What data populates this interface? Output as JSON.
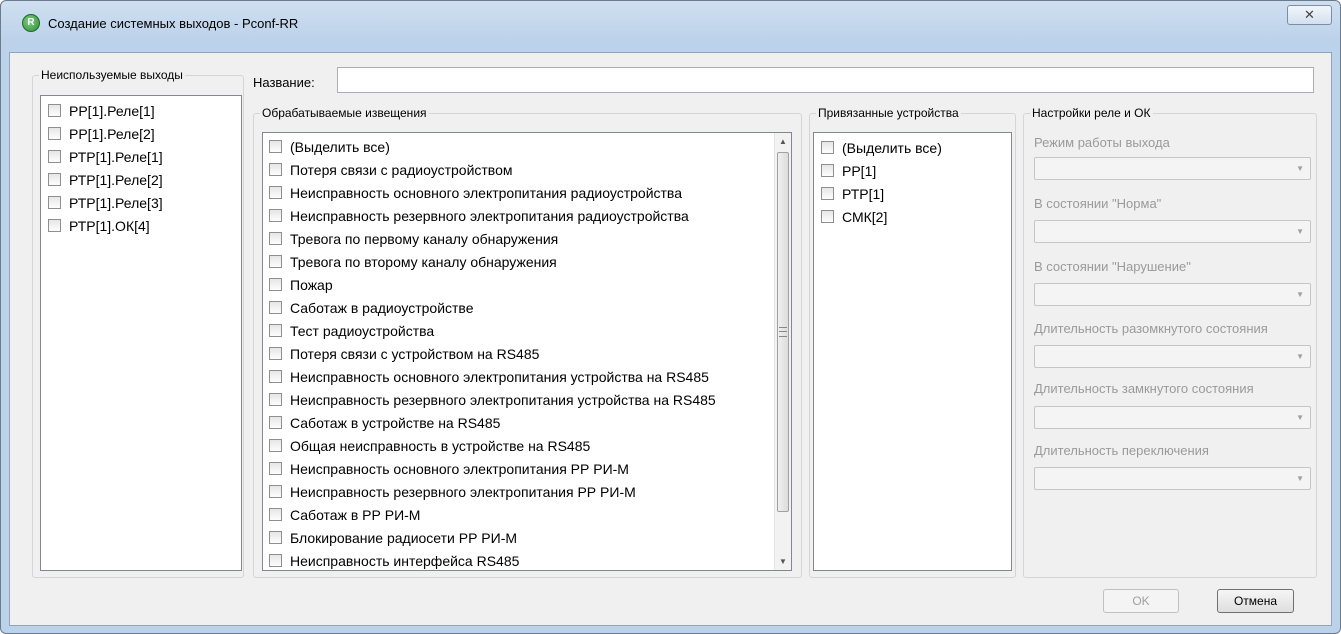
{
  "window": {
    "title": "Создание системных выходов - Pconf-RR",
    "icon_glyph": "R",
    "close_glyph": "✕"
  },
  "unused_outputs": {
    "title": "Неиспользуемые выходы",
    "items": [
      "РР[1].Реле[1]",
      "РР[1].Реле[2]",
      "РТР[1].Реле[1]",
      "РТР[1].Реле[2]",
      "РТР[1].Реле[3]",
      "РТР[1].ОК[4]"
    ]
  },
  "name_field": {
    "label": "Название:",
    "value": ""
  },
  "notifications": {
    "title": "Обрабатываемые извещения",
    "items": [
      "(Выделить все)",
      "Потеря связи с радиоустройством",
      "Неисправность основного электропитания радиоустройства",
      "Неисправность резервного электропитания радиоустройства",
      "Тревога по первому каналу обнаружения",
      "Тревога по второму каналу обнаружения",
      "Пожар",
      "Саботаж в радиоустройстве",
      "Тест радиоустройства",
      "Потеря связи с устройством на RS485",
      "Неисправность основного электропитания устройства на RS485",
      "Неисправность резервного электропитания устройства на RS485",
      "Саботаж в устройстве на RS485",
      "Общая неисправность в устройстве на RS485",
      "Неисправность основного электропитания РР РИ-М",
      "Неисправность резервного электропитания РР РИ-М",
      "Саботаж в РР РИ-М",
      "Блокирование радиосети РР РИ-М",
      "Неисправность интерфейса RS485"
    ]
  },
  "linked_devices": {
    "title": "Привязанные устройства",
    "items": [
      "(Выделить все)",
      "РР[1]",
      "РТР[1]",
      "СМК[2]"
    ]
  },
  "relay_settings": {
    "title": "Настройки реле и ОК",
    "fields": [
      {
        "label": "Режим работы выхода",
        "value": ""
      },
      {
        "label": "В состоянии \"Норма\"",
        "value": ""
      },
      {
        "label": "В состоянии \"Нарушение\"",
        "value": ""
      },
      {
        "label": "Длительность разомкнутого состояния",
        "value": ""
      },
      {
        "label": "Длительность замкнутого состояния",
        "value": ""
      },
      {
        "label": "Длительность переключения",
        "value": ""
      }
    ]
  },
  "buttons": {
    "ok": "OK",
    "cancel": "Отмена"
  }
}
